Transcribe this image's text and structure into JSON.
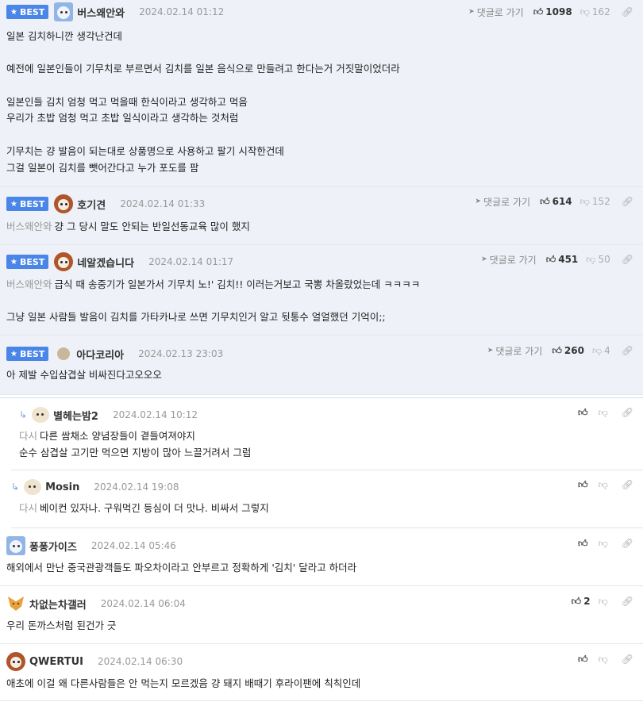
{
  "labels": {
    "best": "BEST",
    "goto": "댓글로 가기"
  },
  "comments": [
    {
      "nick": "버스왜안와",
      "date": "2024.02.14 01:12",
      "best": true,
      "likes": "1098",
      "dislikes": "162",
      "lines": [
        "일본 김치하니깐 생각난건데",
        "",
        "예전에 일본인들이 기무치로 부르면서 김치를 일본 음식으로 만들려고 한다는거 거짓말이었더라",
        "",
        "일본인들 김치 엄청 먹고 먹을때 한식이라고 생각하고 먹음",
        "우리가 초밥 엄청 먹고 초밥 일식이라고 생각하는 것처럼",
        "",
        "기무치는 걍 발음이 되는대로 상품명으로 사용하고 팔기 시작한건데",
        "그걸 일본이 김치를 뺏어간다고 누가 포도를 팜"
      ]
    },
    {
      "nick": "호기견",
      "date": "2024.02.14 01:33",
      "best": true,
      "likes": "614",
      "dislikes": "152",
      "mention": "버스왜안와",
      "lines": [
        "걍 그 당시 말도 안되는 반일선동교육 많이 했지"
      ]
    },
    {
      "nick": "네알겠습니다",
      "date": "2024.02.14 01:17",
      "best": true,
      "likes": "451",
      "dislikes": "50",
      "mention": "버스왜안와",
      "lines": [
        "급식 때 송중기가 일본가서 기무치 노!' 김치!! 이러는거보고 국뽕 차올랐었는데 ㅋㅋㅋㅋ",
        "",
        "그냥 일본 사람들 발음이 김치를 가타카나로 쓰면 기무치인거 알고 뒷통수 얼얼했던 기억이;;"
      ]
    },
    {
      "nick": "아다코리아",
      "date": "2024.02.13 23:03",
      "best": true,
      "likes": "260",
      "dislikes": "4",
      "lines": [
        "아 제발 수입삼겹살 비싸진다고오오오"
      ]
    },
    {
      "nick": "별헤는밤2",
      "date": "2024.02.14 10:12",
      "reply": true,
      "mention": "다시",
      "lines": [
        "다른 쌈채소 양념장들이 곁들여져야지",
        "순수 삼겹살 고기만 먹으면 지방이 많아 느끌거려서 그럼"
      ]
    },
    {
      "nick": "Mosin",
      "date": "2024.02.14 19:08",
      "reply": true,
      "mention": "다시",
      "lines": [
        "베이컨 있자나. 구워먹긴 등심이 더 맛나. 비싸서 그렇지"
      ]
    },
    {
      "nick": "퐁퐁가이즈",
      "date": "2024.02.14 05:46",
      "lines": [
        "해외에서 만난 중국관광객들도 파오차이라고 안부르고 정확하게 '김치' 달라고 하더라"
      ]
    },
    {
      "nick": "차없는차갤러",
      "date": "2024.02.14 06:04",
      "likes": "2",
      "lines": [
        "우리 돈까스처럼 된건가 긋"
      ]
    },
    {
      "nick": "QWERTUI",
      "date": "2024.02.14 06:30",
      "lines": [
        "애초에 이걸 왜 다른사람들은 안 먹는지 모르겠음 걍 돼지 배때기 후라이팬에 칙칙인데"
      ]
    }
  ]
}
